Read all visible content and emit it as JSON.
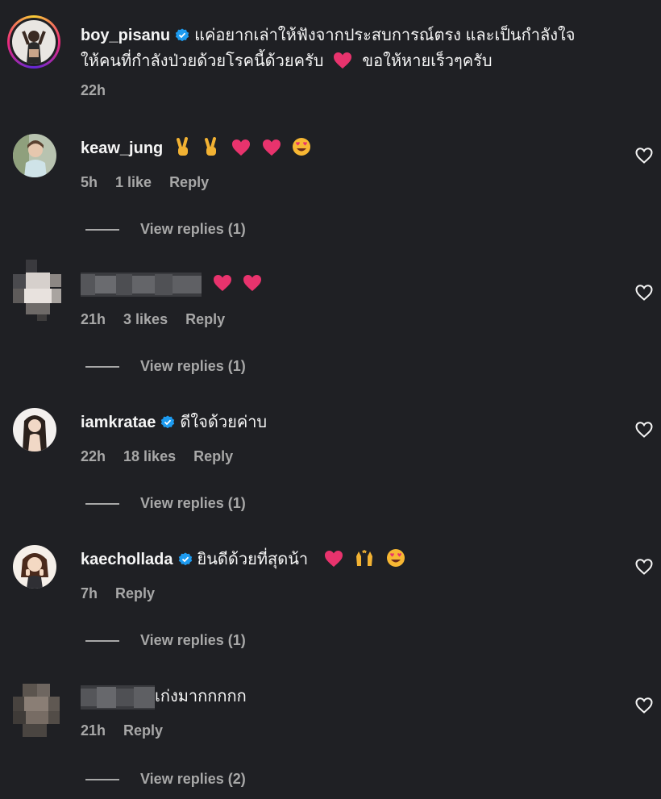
{
  "post": {
    "username": "boy_pisanu",
    "caption_line1": "แค่อยากเล่าให้ฟังจากประสบการณ์ตรง และเป็นกำลังใจ",
    "caption_line2": "ให้คนที่กำลังป่วยด้วยโรคนี้ด้วยครับ",
    "caption_line2_after": "ขอให้หายเร็วๆครับ",
    "time": "22h",
    "verified": true
  },
  "comments": [
    {
      "username": "keaw_jung",
      "verified": false,
      "text": "",
      "emojis": [
        "victory-hand",
        "victory-hand",
        "heart",
        "heart",
        "heart-eyes"
      ],
      "time": "5h",
      "likes": "1 like",
      "reply_label": "Reply",
      "view_replies": "View replies (1)"
    },
    {
      "username": "",
      "blurred": true,
      "verified": false,
      "text": "",
      "emojis": [
        "heart",
        "heart"
      ],
      "time": "21h",
      "likes": "3 likes",
      "reply_label": "Reply",
      "view_replies": "View replies (1)"
    },
    {
      "username": "iamkratae",
      "verified": true,
      "text": "ดีใจด้วยค่าบ",
      "emojis": [],
      "time": "22h",
      "likes": "18 likes",
      "reply_label": "Reply",
      "view_replies": "View replies (1)"
    },
    {
      "username": "kaechollada",
      "verified": true,
      "text": "ยินดีด้วยที่สุดน้า",
      "emojis": [
        "heart",
        "raised-hands",
        "heart-eyes"
      ],
      "time": "7h",
      "likes": "",
      "reply_label": "Reply",
      "view_replies": "View replies (1)"
    },
    {
      "username": "",
      "blurred": true,
      "verified": false,
      "text": "เก่งมากกกกก",
      "emojis": [],
      "time": "21h",
      "likes": "",
      "reply_label": "Reply",
      "view_replies": "View replies (2)"
    }
  ],
  "colors": {
    "background": "#1f2024",
    "text": "#f5f5f5",
    "secondary": "#a8a8a8",
    "verified": "#1d9bf0",
    "heart_emoji": "#e8336d"
  },
  "icons": {
    "like": "heart-outline-icon",
    "verified": "verified-badge-icon"
  }
}
